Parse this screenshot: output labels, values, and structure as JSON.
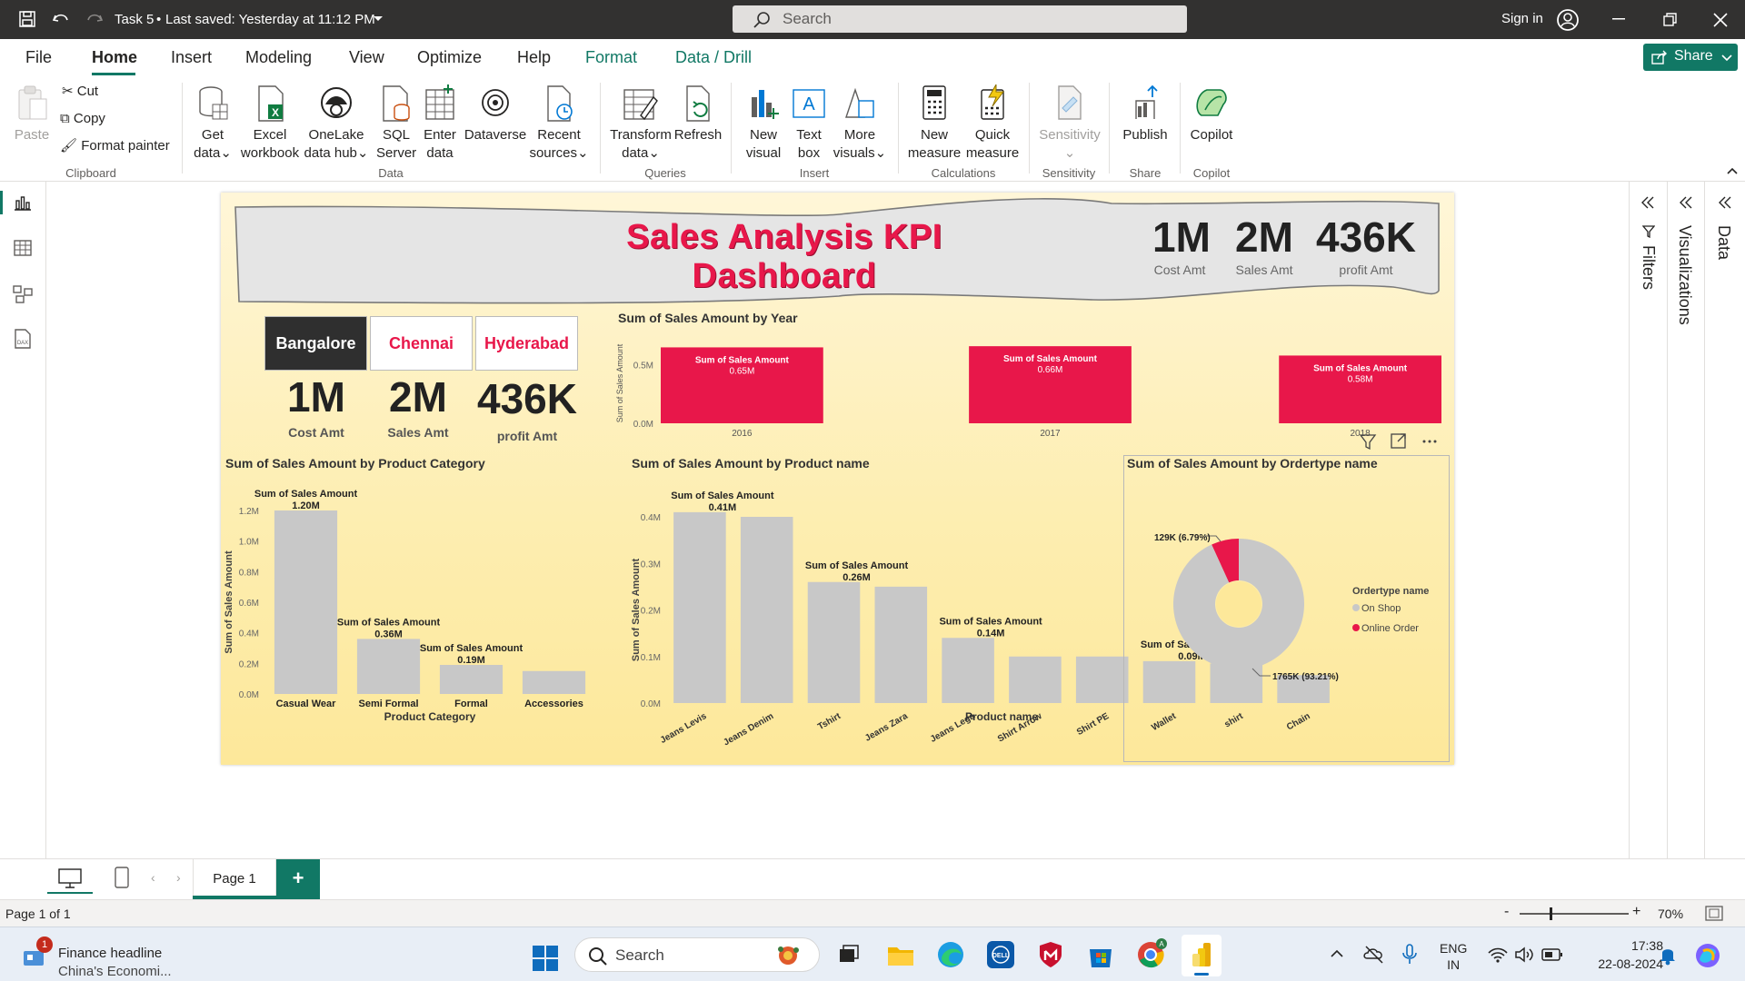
{
  "titlebar": {
    "doc_title": "Task 5",
    "saved": "Last saved: Yesterday at 11:12 PM",
    "search_placeholder": "Search",
    "sign_in": "Sign in"
  },
  "menu": {
    "items": [
      "File",
      "Home",
      "Insert",
      "Modeling",
      "View",
      "Optimize",
      "Help",
      "Format",
      "Data / Drill"
    ],
    "active": "Home",
    "share": "Share"
  },
  "ribbon": {
    "clipboard": {
      "paste": "Paste",
      "cut": "Cut",
      "copy": "Copy",
      "format_painter": "Format painter",
      "group": "Clipboard"
    },
    "data": {
      "get_data": [
        "Get",
        "data"
      ],
      "excel": [
        "Excel",
        "workbook"
      ],
      "onelake": [
        "OneLake",
        "data hub"
      ],
      "sql": [
        "SQL",
        "Server"
      ],
      "enter": [
        "Enter",
        "data"
      ],
      "dataverse": "Dataverse",
      "recent": [
        "Recent",
        "sources"
      ],
      "group": "Data"
    },
    "queries": {
      "transform": [
        "Transform",
        "data"
      ],
      "refresh": "Refresh",
      "group": "Queries"
    },
    "insert": {
      "new_visual": [
        "New",
        "visual"
      ],
      "text_box": [
        "Text",
        "box"
      ],
      "more": [
        "More",
        "visuals"
      ],
      "group": "Insert"
    },
    "calculations": {
      "new_measure": [
        "New",
        "measure"
      ],
      "quick_measure": [
        "Quick",
        "measure"
      ],
      "group": "Calculations"
    },
    "sensitivity": {
      "label": "Sensitivity",
      "group": "Sensitivity"
    },
    "share": {
      "publish": "Publish",
      "group": "Share"
    },
    "copilot": {
      "label": "Copilot",
      "group": "Copilot"
    }
  },
  "report": {
    "title": "Sales Analysis KPI Dashboard",
    "header_kpis": [
      {
        "value": "1M",
        "label": "Cost Amt"
      },
      {
        "value": "2M",
        "label": "Sales Amt"
      },
      {
        "value": "436K",
        "label": "profit Amt"
      }
    ],
    "cities": [
      "Bangalore",
      "Chennai",
      "Hyderabad"
    ],
    "kpis": [
      {
        "value": "1M",
        "label": "Cost Amt"
      },
      {
        "value": "2M",
        "label": "Sales Amt"
      },
      {
        "value": "436K",
        "label": "profit Amt"
      }
    ]
  },
  "chart_data": [
    {
      "type": "bar",
      "title": "Sum of Sales Amount by Year",
      "ylabel": "Sum of Sales Amount",
      "xlabel": "",
      "categories": [
        "2016",
        "2017",
        "2018"
      ],
      "values": [
        0.65,
        0.66,
        0.58
      ],
      "value_unit": "M",
      "series_label": "Sum of Sales Amount",
      "data_labels": [
        "0.65M",
        "0.66M",
        "0.58M"
      ],
      "yticks": [
        "0.0M",
        "0.5M"
      ],
      "ylim": [
        0,
        0.7
      ],
      "color": "#e8174a"
    },
    {
      "type": "bar",
      "title": "Sum of Sales Amount by Product Category",
      "xlabel": "Product Category",
      "ylabel": "Sum of Sales Amount",
      "categories": [
        "Casual Wear",
        "Semi Formal",
        "Formal",
        "Accessories"
      ],
      "values": [
        1.2,
        0.36,
        0.19,
        0.15
      ],
      "value_unit": "M",
      "series_label": "Sum of Sales Amount",
      "data_labels": [
        "1.20M",
        "0.36M",
        "0.19M",
        ""
      ],
      "yticks": [
        "0.0M",
        "0.2M",
        "0.4M",
        "0.6M",
        "0.8M",
        "1.0M",
        "1.2M"
      ],
      "ylim": [
        0,
        1.2
      ],
      "color": "#c8c8c8"
    },
    {
      "type": "bar",
      "title": "Sum of Sales Amount by Product name",
      "xlabel": "Product name",
      "ylabel": "Sum of Sales Amount",
      "categories": [
        "Jeans Levis",
        "Jeans Denim",
        "Tshirt",
        "Jeans Zara",
        "Jeans Lega",
        "Shirt Arrow",
        "Shirt PE",
        "Wallet",
        "shirt",
        "Chain"
      ],
      "values": [
        0.41,
        0.4,
        0.26,
        0.25,
        0.14,
        0.1,
        0.1,
        0.09,
        0.085,
        0.06
      ],
      "value_unit": "M",
      "series_label": "Sum of Sales Amount",
      "data_labels": [
        "0.41M",
        "",
        "0.26M",
        "",
        "0.14M",
        "",
        "",
        "0.09M",
        "",
        ""
      ],
      "yticks": [
        "0.0M",
        "0.1M",
        "0.2M",
        "0.3M",
        "0.4M"
      ],
      "ylim": [
        0,
        0.4
      ],
      "color": "#c8c8c8"
    },
    {
      "type": "pie",
      "title": "Sum of Sales Amount by Ordertype name",
      "legend_title": "Ordertype name",
      "categories": [
        "On Shop",
        "Online Order"
      ],
      "values": [
        1765,
        129
      ],
      "value_unit": "K",
      "data_labels": [
        "1765K (93.21%)",
        "129K (6.79%)"
      ],
      "colors": [
        "#c8c8c8",
        "#e8174a"
      ]
    }
  ],
  "right_panes": [
    "Filters",
    "Visualizations",
    "Data"
  ],
  "pages": {
    "current": "Page 1",
    "status": "Page 1 of 1",
    "zoom": "70%"
  },
  "taskbar": {
    "news_title": "Finance headline",
    "news_sub": "China's Economi...",
    "search": "Search",
    "lang": [
      "ENG",
      "IN"
    ],
    "time": "17:38",
    "date": "22-08-2024",
    "notif": "1"
  }
}
